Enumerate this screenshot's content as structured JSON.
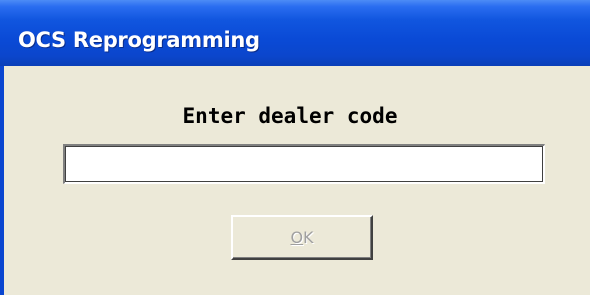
{
  "window": {
    "title": "OCS Reprogramming"
  },
  "dialog": {
    "prompt": "Enter dealer code",
    "dealer_code": {
      "value": ""
    },
    "ok_button": {
      "mnemonic": "O",
      "rest": "K",
      "enabled": false
    }
  },
  "colors": {
    "titlebar": "#0a4ad6",
    "dialog_face": "#ece9d8",
    "disabled_text": "#a0a0a0"
  }
}
